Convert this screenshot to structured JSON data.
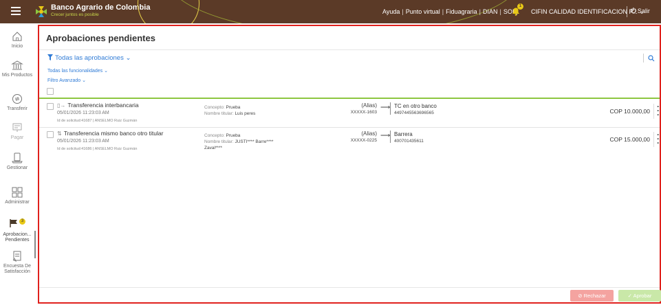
{
  "topbar": {
    "bank_name": "Banco Agrario de Colombia",
    "bank_tagline": "Crecer juntos es posible",
    "links": [
      "Ayuda",
      "Punto virtual",
      "Fiduagraria",
      "DIAN",
      "SOI"
    ],
    "notification_count": "1",
    "company": "CIFIN CALIDAD IDENTIFICACION P...",
    "exit_label": "Salir"
  },
  "sidebar": {
    "items": [
      {
        "label": "Inicio",
        "icon": "home-icon"
      },
      {
        "label": "Mis Productos",
        "icon": "bank-icon"
      },
      {
        "label": "Transferir",
        "icon": "transfer-icon"
      },
      {
        "label": "Pagar",
        "icon": "pay-icon"
      },
      {
        "label": "Gestionar",
        "icon": "manage-icon"
      },
      {
        "label": "Administrar",
        "icon": "admin-icon"
      },
      {
        "label": "Aprobacion... Pendientes",
        "icon": "flag-icon",
        "badge": "3"
      },
      {
        "label": "Encuesta De Satisfacción",
        "icon": "survey-icon"
      }
    ]
  },
  "main": {
    "title": "Aprobaciones pendientes",
    "filter_all": "Todas las aprobaciones",
    "filter_functionalities": "Todas las funcionalidades",
    "advanced_filter": "Filtro Avanzado",
    "rows": [
      {
        "type": "Transferencia interbancaria",
        "date": "05/01/2026 11:23:03 AM",
        "meta": "Id de solicitud:41687 | ANSELMO Ruiz Guzmán",
        "concept_label": "Concepto:",
        "concept": "Prueba",
        "holder_label": "Nombre titular:",
        "holder": "Luis peres",
        "holder_line2": "",
        "alias": "(Alias)",
        "account": "XXXXX-1603",
        "destination": "TC en otro banco",
        "destination_number": "4497445563696565",
        "amount": "COP 10.000,00"
      },
      {
        "type": "Transferencia mismo banco otro titular",
        "date": "05/01/2026 11:23:03 AM",
        "meta": "Id de solicitud:41686 | ANSELMO Ruiz Guzmán",
        "concept_label": "Concepto:",
        "concept": "Prueba",
        "holder_label": "Nombre titular:",
        "holder": "JUSTI**** Barre****",
        "holder_line2": "Zaval****",
        "alias": "(Alias)",
        "account": "XXXXX-0225",
        "destination": "Barrera",
        "destination_number": "400701435611",
        "amount": "COP 15.000,00"
      }
    ],
    "reject_label": "Rechazar",
    "approve_label": "Aprobar"
  },
  "colors": {
    "topbar": "#5b3a27",
    "accent_blue": "#2f7bd6",
    "accent_green": "#8cc63f",
    "highlight_border": "#e0201c",
    "badge_yellow": "#e8c816"
  }
}
